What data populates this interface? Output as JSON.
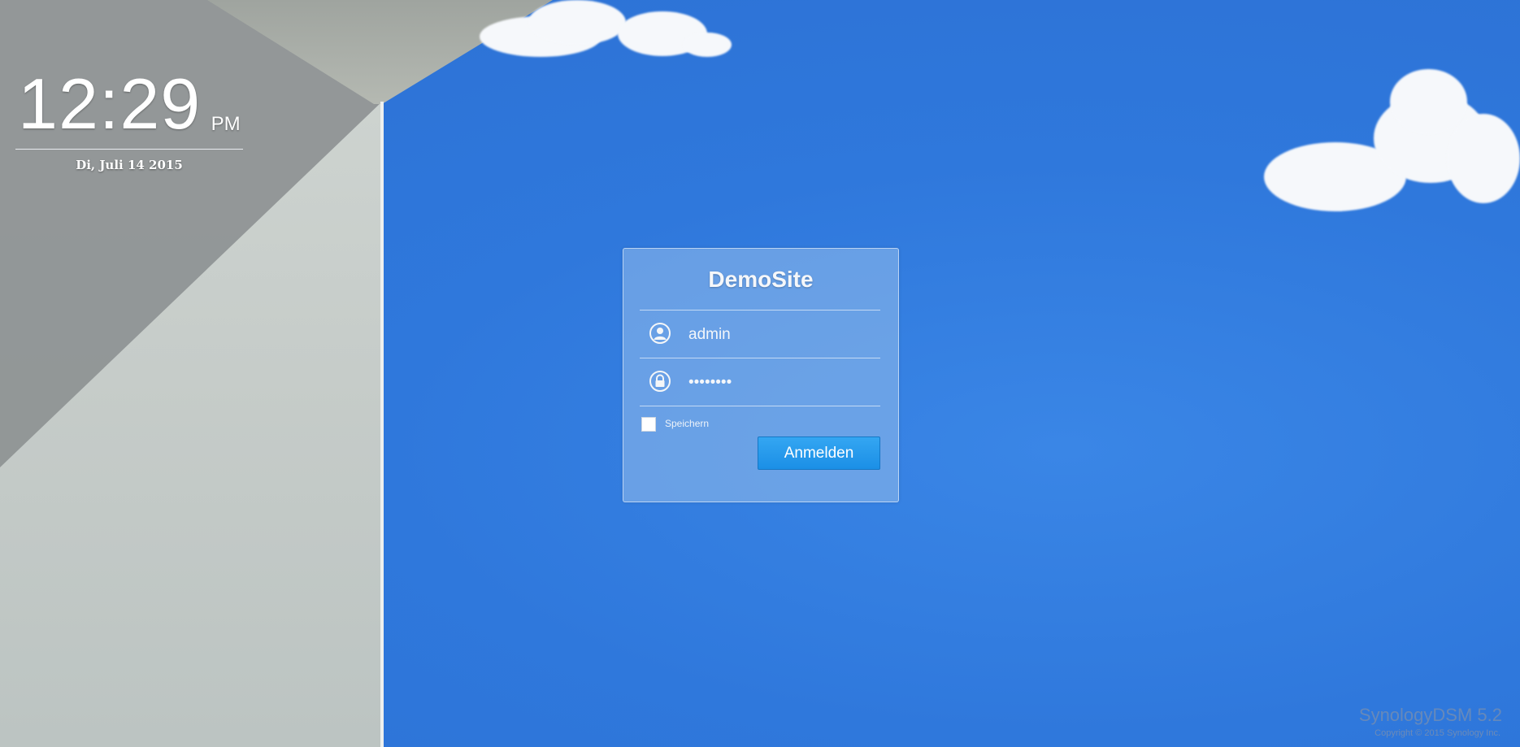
{
  "clock": {
    "time": "12:29",
    "ampm": "PM",
    "date": "Di, Juli 14 2015"
  },
  "login": {
    "title": "DemoSite",
    "username_value": "admin",
    "password_value": "••••••••",
    "remember_label": "Speichern",
    "submit_label": "Anmelden"
  },
  "footer": {
    "brand": "Synology",
    "version": "DSM 5.2",
    "copyright": "Copyright © 2015 Synology Inc."
  },
  "colors": {
    "sky": "#2f78dc",
    "button": "#1b8fe6"
  },
  "icons": {
    "username": "user-icon",
    "password": "lock-icon"
  }
}
